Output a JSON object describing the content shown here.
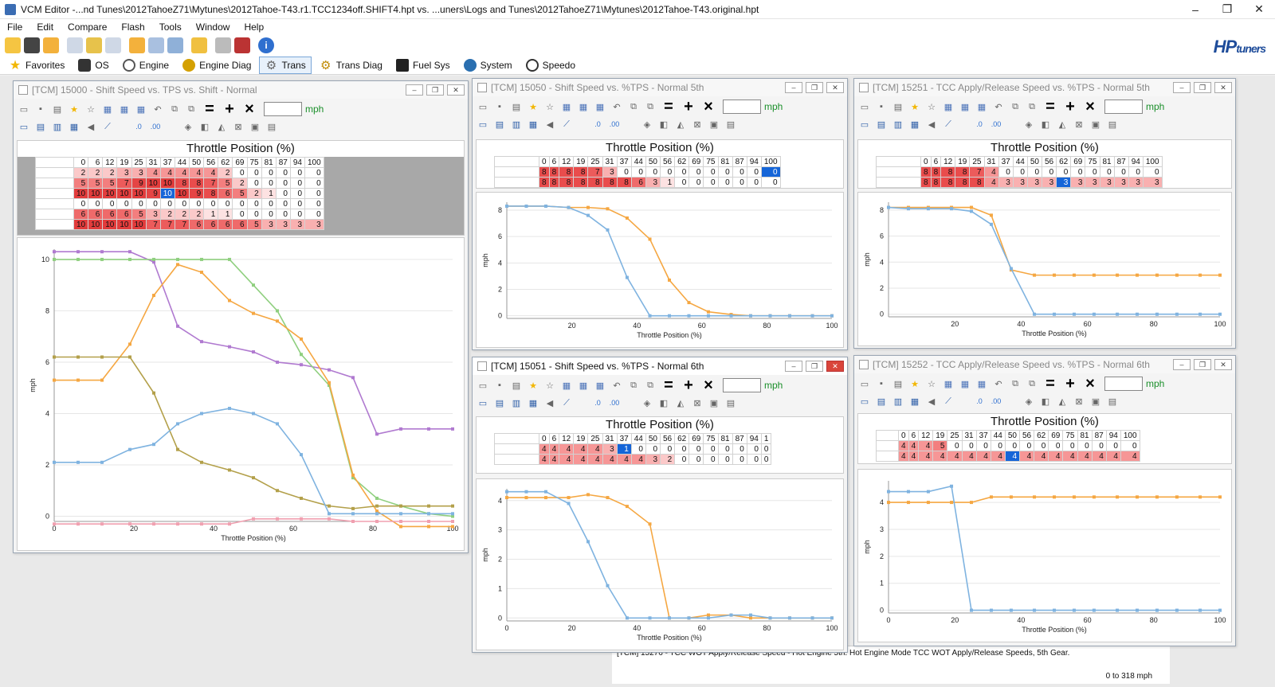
{
  "app": {
    "title": "VCM Editor -...nd Tunes\\2012TahoeZ71\\Mytunes\\2012Tahoe-T43.r1.TCC1234off.SHIFT4.hpt vs. ...uners\\Logs and Tunes\\2012TahoeZ71\\Mytunes\\2012Tahoe-T43.original.hpt",
    "window_controls": [
      "–",
      "❐",
      "✕"
    ]
  },
  "menu": [
    "File",
    "Edit",
    "Compare",
    "Flash",
    "Tools",
    "Window",
    "Help"
  ],
  "logo": {
    "main": "HP",
    "sub": "tuners"
  },
  "nav_tabs": [
    {
      "label": "Favorites",
      "icon": "star-icon",
      "color": "#f2b705"
    },
    {
      "label": "OS",
      "icon": "chip-icon",
      "color": "#333333"
    },
    {
      "label": "Engine",
      "icon": "engine-icon",
      "color": "#555555"
    },
    {
      "label": "Engine Diag",
      "icon": "engine-diag-icon",
      "color": "#d4a000"
    },
    {
      "label": "Trans",
      "icon": "gear-icon",
      "color": "#666666",
      "active": true
    },
    {
      "label": "Trans Diag",
      "icon": "trans-diag-icon",
      "color": "#c08a00"
    },
    {
      "label": "Fuel Sys",
      "icon": "fuel-pump-icon",
      "color": "#222222"
    },
    {
      "label": "System",
      "icon": "system-icon",
      "color": "#2a6fb0"
    },
    {
      "label": "Speedo",
      "icon": "speedometer-icon",
      "color": "#333333"
    }
  ],
  "common_x": [
    0,
    6,
    12,
    19,
    25,
    31,
    37,
    44,
    50,
    56,
    62,
    69,
    75,
    81,
    87,
    94,
    100
  ],
  "windows": [
    {
      "id": "w1",
      "title": "[TCM] 15000 - Shift Speed vs. TPS vs. Shift - Normal",
      "active": false,
      "unit": "mph",
      "axis_title": "Throttle Position (%)",
      "header_last": "100",
      "rows": [
        [
          2,
          2,
          2,
          3,
          3,
          4,
          4,
          4,
          4,
          4,
          2,
          0,
          0,
          0,
          0,
          0,
          0
        ],
        [
          5,
          5,
          5,
          7,
          9,
          10,
          10,
          8,
          8,
          7,
          5,
          2,
          0,
          0,
          0,
          0,
          0
        ],
        [
          10,
          10,
          10,
          10,
          10,
          9,
          10,
          10,
          9,
          8,
          6,
          5,
          2,
          1,
          0,
          0,
          0
        ],
        [
          0,
          0,
          0,
          0,
          0,
          0,
          0,
          0,
          0,
          0,
          0,
          0,
          0,
          0,
          0,
          0,
          0
        ],
        [
          6,
          6,
          6,
          6,
          5,
          3,
          2,
          2,
          2,
          1,
          1,
          0,
          0,
          0,
          0,
          0,
          0
        ],
        [
          10,
          10,
          10,
          10,
          10,
          7,
          7,
          7,
          6,
          6,
          6,
          6,
          5,
          3,
          3,
          3,
          3
        ]
      ],
      "selected_cell": [
        2,
        6
      ],
      "chart": {
        "ylabel": "mph",
        "xlabel": "Throttle Position (%)",
        "ylim": [
          -0.2,
          10.4
        ],
        "yticks": [
          0,
          2,
          4,
          6,
          8,
          10
        ],
        "xticks": [
          0,
          20,
          40,
          60,
          80,
          100
        ],
        "series": [
          {
            "color": "#b07ad0",
            "values": [
              10.3,
              10.3,
              10.3,
              10.3,
              9.9,
              7.4,
              6.8,
              6.6,
              6.4,
              6.0,
              5.9,
              5.7,
              5.4,
              3.2,
              3.4,
              3.4,
              3.4
            ]
          },
          {
            "color": "#8fcf7f",
            "values": [
              10,
              10,
              10,
              10,
              10,
              10,
              10,
              10,
              9.0,
              8.0,
              6.3,
              5.1,
              1.5,
              0.7,
              0.4,
              0.1,
              0
            ]
          },
          {
            "color": "#f5a742",
            "values": [
              5.3,
              5.3,
              5.3,
              6.7,
              8.6,
              9.8,
              9.5,
              8.4,
              7.9,
              7.6,
              6.9,
              5.2,
              1.6,
              0.2,
              -0.4,
              -0.4,
              -0.4
            ]
          },
          {
            "color": "#b3a04a",
            "values": [
              6.2,
              6.2,
              6.2,
              6.2,
              4.8,
              2.6,
              2.1,
              1.8,
              1.5,
              1.0,
              0.7,
              0.4,
              0.3,
              0.4,
              0.4,
              0.4,
              0.4
            ]
          },
          {
            "color": "#7fb3e0",
            "values": [
              2.1,
              2.1,
              2.1,
              2.6,
              2.8,
              3.6,
              4.0,
              4.2,
              4.0,
              3.6,
              2.4,
              0.1,
              0.1,
              0.1,
              0.1,
              0.1,
              0.1
            ]
          },
          {
            "color": "#f0a0b0",
            "values": [
              -0.3,
              -0.3,
              -0.3,
              -0.3,
              -0.3,
              -0.3,
              -0.3,
              -0.3,
              -0.1,
              -0.1,
              -0.1,
              -0.1,
              -0.2,
              -0.2,
              -0.2,
              -0.2,
              -0.2
            ]
          }
        ]
      }
    },
    {
      "id": "w2",
      "title": "[TCM] 15050 - Shift Speed vs. %TPS - Normal 5th",
      "active": false,
      "unit": "mph",
      "axis_title": "Throttle Position (%)",
      "header_last": "100",
      "rows": [
        [
          8,
          8,
          8,
          8,
          7,
          3,
          0,
          0,
          0,
          0,
          0,
          0,
          0,
          0,
          0,
          0,
          0
        ],
        [
          8,
          8,
          8,
          8,
          8,
          8,
          8,
          6,
          3,
          1,
          0,
          0,
          0,
          0,
          0,
          0,
          0
        ]
      ],
      "selected_cell": [
        0,
        16
      ],
      "chart": {
        "ylabel": "mph",
        "xlabel": "Throttle Position (%)",
        "ylim": [
          -0.2,
          8.6
        ],
        "yticks": [
          0,
          2,
          4,
          6,
          8
        ],
        "xticks": [
          20,
          40,
          60,
          80,
          100
        ],
        "series": [
          {
            "color": "#f5a742",
            "values": [
              8.3,
              8.3,
              8.3,
              8.2,
              8.2,
              8.1,
              7.4,
              5.8,
              2.7,
              1.0,
              0.3,
              0.1,
              0,
              0,
              0,
              0,
              0
            ]
          },
          {
            "color": "#7fb3e0",
            "values": [
              8.3,
              8.3,
              8.3,
              8.2,
              7.6,
              6.5,
              2.9,
              0,
              0,
              0,
              0,
              0,
              0,
              0,
              0,
              0,
              0
            ]
          }
        ]
      }
    },
    {
      "id": "w3",
      "title": "[TCM] 15251 - TCC Apply/Release Speed vs. %TPS - Normal 5th",
      "active": false,
      "unit": "mph",
      "axis_title": "Throttle Position (%)",
      "header_last": "100",
      "rows": [
        [
          8,
          8,
          8,
          8,
          7,
          4,
          0,
          0,
          0,
          0,
          0,
          0,
          0,
          0,
          0,
          0,
          0
        ],
        [
          8,
          8,
          8,
          8,
          8,
          4,
          3,
          3,
          3,
          3,
          3,
          3,
          3,
          3,
          3,
          3,
          3
        ]
      ],
      "selected_cell": [
        1,
        10
      ],
      "chart": {
        "ylabel": "mph",
        "xlabel": "Throttle Position (%)",
        "ylim": [
          -0.2,
          8.6
        ],
        "yticks": [
          0,
          2,
          4,
          6,
          8
        ],
        "xticks": [
          20,
          40,
          60,
          80,
          100
        ],
        "series": [
          {
            "color": "#f5a742",
            "values": [
              8.2,
              8.2,
              8.2,
              8.2,
              8.2,
              7.6,
              3.4,
              3.0,
              3.0,
              3.0,
              3.0,
              3.0,
              3.0,
              3.0,
              3.0,
              3.0,
              3.0
            ]
          },
          {
            "color": "#7fb3e0",
            "values": [
              8.2,
              8.1,
              8.1,
              8.1,
              7.9,
              6.9,
              3.5,
              0,
              0,
              0,
              0,
              0,
              0,
              0,
              0,
              0,
              0
            ]
          }
        ]
      }
    },
    {
      "id": "w4",
      "title": "[TCM] 15051 - Shift Speed vs. %TPS - Normal 6th",
      "active": true,
      "unit": "mph",
      "axis_title": "Throttle Position (%)",
      "header_last": "1",
      "rows": [
        [
          4,
          4,
          4,
          4,
          4,
          3,
          1,
          0,
          0,
          0,
          0,
          0,
          0,
          0,
          0,
          0,
          0
        ],
        [
          4,
          4,
          4,
          4,
          4,
          4,
          4,
          4,
          3,
          2,
          0,
          0,
          0,
          0,
          0,
          0,
          0
        ]
      ],
      "selected_cell": [
        0,
        6
      ],
      "chart": {
        "ylabel": "mph",
        "xlabel": "Throttle Position (%)",
        "ylim": [
          -0.1,
          4.4
        ],
        "yticks": [
          0,
          1,
          2,
          3,
          4
        ],
        "xticks": [
          0,
          20,
          40,
          60,
          80,
          100
        ],
        "series": [
          {
            "color": "#f5a742",
            "values": [
              4.1,
              4.1,
              4.1,
              4.1,
              4.2,
              4.1,
              3.8,
              3.2,
              0,
              0,
              0.1,
              0.1,
              0,
              0,
              0,
              0,
              0
            ]
          },
          {
            "color": "#7fb3e0",
            "values": [
              4.3,
              4.3,
              4.3,
              3.9,
              2.6,
              1.1,
              0,
              0,
              0,
              0,
              0,
              0.1,
              0.1,
              0,
              0,
              0,
              0
            ]
          }
        ]
      }
    },
    {
      "id": "w5",
      "title": "[TCM] 15252 - TCC Apply/Release Speed vs. %TPS - Normal 6th",
      "active": false,
      "unit": "mph",
      "axis_title": "Throttle Position (%)",
      "header_last": "100",
      "rows": [
        [
          4,
          4,
          4,
          5,
          0,
          0,
          0,
          0,
          0,
          0,
          0,
          0,
          0,
          0,
          0,
          0,
          0
        ],
        [
          4,
          4,
          4,
          4,
          4,
          4,
          4,
          4,
          4,
          4,
          4,
          4,
          4,
          4,
          4,
          4,
          4
        ]
      ],
      "selected_cell": [
        1,
        8
      ],
      "chart": {
        "ylabel": "mph",
        "xlabel": "Throttle Position (%)",
        "ylim": [
          -0.1,
          4.8
        ],
        "yticks": [
          0,
          1,
          2,
          3,
          4
        ],
        "xticks": [
          0,
          20,
          40,
          60,
          80,
          100
        ],
        "series": [
          {
            "color": "#f5a742",
            "values": [
              4.0,
              4.0,
              4.0,
              4.0,
              4.0,
              4.2,
              4.2,
              4.2,
              4.2,
              4.2,
              4.2,
              4.2,
              4.2,
              4.2,
              4.2,
              4.2,
              4.2
            ]
          },
          {
            "color": "#7fb3e0",
            "values": [
              4.4,
              4.4,
              4.4,
              4.6,
              0,
              0,
              0,
              0,
              0,
              0,
              0,
              0,
              0,
              0,
              0,
              0,
              0
            ]
          }
        ]
      }
    }
  ],
  "status": {
    "text": "[TCM] 15276 - TCC WOT Apply/Release Speed - Hot Engine 5th. Hot Engine Mode TCC WOT Apply/Release Speeds, 5th Gear.",
    "range": "0 to 318 mph"
  }
}
